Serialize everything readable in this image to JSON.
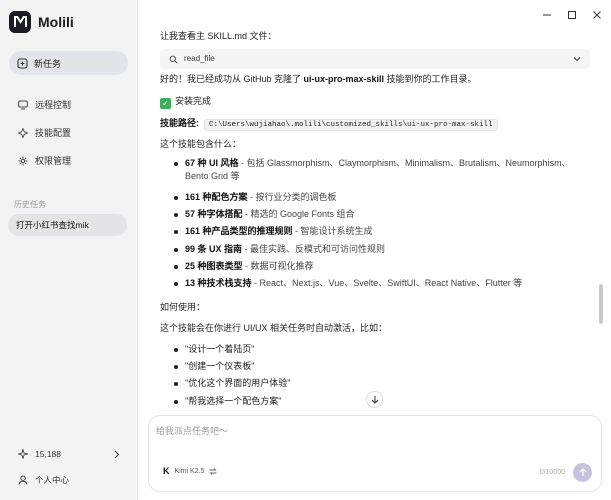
{
  "app": {
    "name": "Molili"
  },
  "sidebar": {
    "new_task": "新任务",
    "nav": [
      {
        "label": "远程控制",
        "icon": "monitor-icon"
      },
      {
        "label": "技能配置",
        "icon": "skill-icon"
      },
      {
        "label": "权限管理",
        "icon": "permission-icon"
      }
    ],
    "history_label": "历史任务",
    "history": [
      {
        "label": "打开小红书查找mik"
      }
    ],
    "credits": "15,188",
    "user_center": "个人中心"
  },
  "window": {
    "controls": [
      "minimize",
      "maximize",
      "close"
    ]
  },
  "chat": {
    "intro": "让我查看主 SKILL.md 文件：",
    "tool_call": {
      "name": "read_file"
    },
    "success_pre": "好的！我已经成功从 GitHub 克隆了 ",
    "success_bold": "ui-ux-pro-max-skill",
    "success_post": " 技能到你的工作目录。",
    "install_done": "安装完成",
    "path_label": "技能路径:",
    "path_value": "C:\\Users\\wujiahao\\.molili\\customized_skills\\ui-ux-pro-max-skill",
    "includes_title": "这个技能包含什么：",
    "features": [
      {
        "bold": "67 种 UI 风格",
        "desc": " - 包括 Glassmorphism、Claymorphism、Minimalism、Brutalism、Neumorphism、Bento Grid 等"
      },
      {
        "bold": "161 种配色方案",
        "desc": " - 按行业分类的调色板"
      },
      {
        "bold": "57 种字体搭配",
        "desc": " - 精选的 Google Fonts 组合"
      },
      {
        "bold": "161 种产品类型的推理规则",
        "desc": " - 智能设计系统生成"
      },
      {
        "bold": "99 条 UX 指南",
        "desc": " - 最佳实践、反模式和可访问性规则"
      },
      {
        "bold": "25 种图表类型",
        "desc": " - 数据可视化推荐"
      },
      {
        "bold": "13 种技术栈支持",
        "desc": " - React、Next.js、Vue、Svelte、SwiftUI、React Native、Flutter 等"
      }
    ],
    "usage_title": "如何使用：",
    "usage_desc": "这个技能会在你进行 UI/UX 相关任务时自动激活，比如：",
    "examples": [
      "\"设计一个着陆页\"",
      "\"创建一个仪表板\"",
      "\"优化这个界面的用户体验\"",
      "\"帮我选择一个配色方案\""
    ]
  },
  "composer": {
    "placeholder": "给我派点任务吧～",
    "model_name": "Kimi K2.5",
    "counter": "0/10000"
  }
}
